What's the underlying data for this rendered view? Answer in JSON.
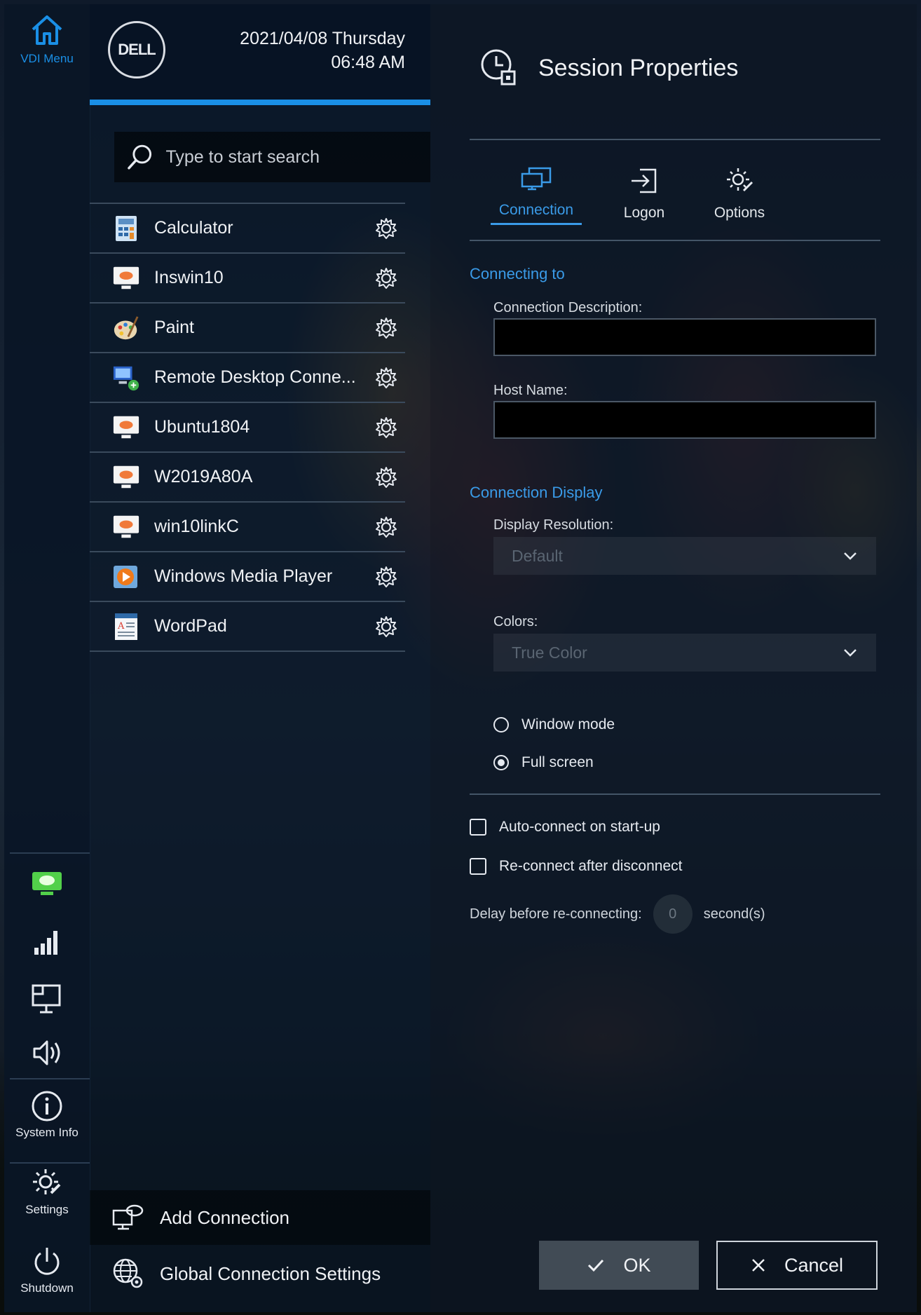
{
  "rail": {
    "vdi_menu_label": "VDI Menu",
    "system_info_label": "System Info",
    "settings_label": "Settings",
    "shutdown_label": "Shutdown",
    "accent": "#1a8fe6"
  },
  "header": {
    "date": "2021/04/08 Thursday",
    "time": "06:48 AM",
    "logo_text": "DELL"
  },
  "search": {
    "placeholder": "Type to start search"
  },
  "connections": [
    {
      "label": "Calculator",
      "icon": "calculator-icon"
    },
    {
      "label": "Inswin10",
      "icon": "vdi-cloud-icon"
    },
    {
      "label": "Paint",
      "icon": "paint-icon"
    },
    {
      "label": "Remote Desktop Conne...",
      "icon": "remote-desktop-icon"
    },
    {
      "label": "Ubuntu1804",
      "icon": "vdi-cloud-icon"
    },
    {
      "label": "W2019A80A",
      "icon": "vdi-cloud-icon"
    },
    {
      "label": "win10linkC",
      "icon": "vdi-cloud-icon"
    },
    {
      "label": "Windows Media Player",
      "icon": "media-player-icon"
    },
    {
      "label": "WordPad",
      "icon": "wordpad-icon"
    }
  ],
  "launcher_footer": {
    "add_connection": "Add Connection",
    "global_settings": "Global Connection Settings"
  },
  "panel": {
    "title": "Session Properties",
    "tabs": [
      {
        "label": "Connection",
        "active": true
      },
      {
        "label": "Logon",
        "active": false
      },
      {
        "label": "Options",
        "active": false
      }
    ],
    "connecting_to": "Connecting to",
    "connection_description_label": "Connection Description:",
    "connection_description_value": "",
    "host_name_label": "Host Name:",
    "host_name_value": "",
    "connection_display": "Connection Display",
    "display_resolution_label": "Display Resolution:",
    "display_resolution_value": "Default",
    "colors_label": "Colors:",
    "colors_value": "True Color",
    "window_mode": "Window mode",
    "full_screen": "Full screen",
    "auto_connect": "Auto-connect on start-up",
    "reconnect": "Re-connect after disconnect",
    "delay_label": "Delay before re-connecting:",
    "delay_value": "0",
    "delay_unit": "second(s)",
    "ok": "OK",
    "cancel": "Cancel"
  }
}
